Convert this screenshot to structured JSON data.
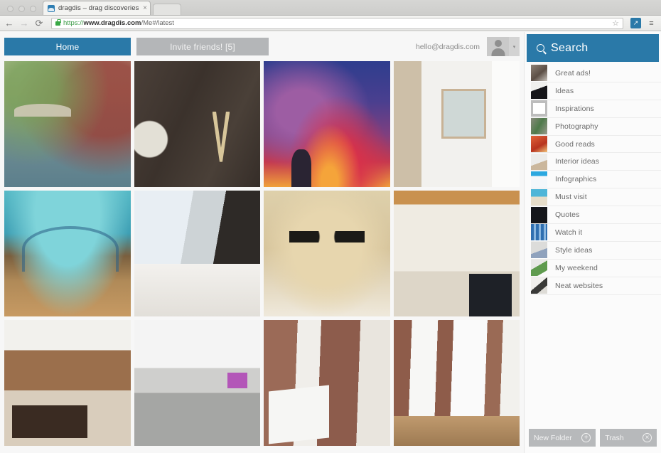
{
  "browser": {
    "tab": {
      "title": "dragdis – drag discoveries",
      "close_label": "×",
      "favicon": "dragdis-favicon"
    },
    "toolbar": {
      "back_label": "←",
      "forward_label": "→",
      "reload_label": "⟳",
      "url_scheme": "https",
      "url_separator": "://",
      "url_host": "www.dragdis.com",
      "url_path": "/Me#/latest",
      "bookmark_label": "☆",
      "extension_label": "↗",
      "menu_label": "≡"
    }
  },
  "appnav": {
    "home_label": "Home",
    "invite_label": "Invite friends! [5]",
    "user_email": "hello@dragdis.com",
    "caret_label": "▾"
  },
  "grid": {
    "tiles": [
      {
        "name": "venice-canal-bridge-boat",
        "art": "img-canal"
      },
      {
        "name": "live-food-lettering-wood",
        "art": "img-live"
      },
      {
        "name": "buddha-statue-sunset-sky",
        "art": "img-sunset"
      },
      {
        "name": "white-wood-wall-interior",
        "art": "img-whiteroom"
      },
      {
        "name": "underwater-aquarium-bedroom",
        "art": "img-underwater"
      },
      {
        "name": "attic-loft-bedroom-chandelier",
        "art": "img-attic"
      },
      {
        "name": "leopard-face-closeup",
        "art": "img-leopard"
      },
      {
        "name": "open-plan-loft-staircase",
        "art": "img-loft"
      },
      {
        "name": "classic-living-room-shelves",
        "art": "img-living"
      },
      {
        "name": "modern-open-office-imacs",
        "art": "img-office"
      },
      {
        "name": "brick-wall-kitchen-island",
        "art": "img-kitchen"
      },
      {
        "name": "brick-wall-white-doors",
        "art": "img-doors"
      }
    ]
  },
  "sidebar": {
    "search_label": "Search",
    "folders": [
      {
        "label": "Great ads!",
        "thumb": "t-greatads"
      },
      {
        "label": "Ideas",
        "thumb": "t-ideas"
      },
      {
        "label": "Inspirations",
        "thumb": "t-inspirations"
      },
      {
        "label": "Photography",
        "thumb": "t-photography"
      },
      {
        "label": "Good reads",
        "thumb": "t-goodreads"
      },
      {
        "label": "Interior ideas",
        "thumb": "t-interior"
      },
      {
        "label": "Infographics",
        "thumb": "t-infographics"
      },
      {
        "label": "Must visit",
        "thumb": "t-mustvisit"
      },
      {
        "label": "Quotes",
        "thumb": "t-quotes"
      },
      {
        "label": "Watch it",
        "thumb": "t-watchit"
      },
      {
        "label": "Style ideas",
        "thumb": "t-styleideas"
      },
      {
        "label": "My weekend",
        "thumb": "t-myweekend"
      },
      {
        "label": "Neat websites",
        "thumb": "t-neatwebsites"
      }
    ],
    "new_folder_label": "New Folder",
    "new_folder_icon": "+",
    "trash_label": "Trash",
    "trash_icon": "×"
  },
  "colors": {
    "accent_blue": "#2a79a8",
    "muted_gray": "#b7b9bb",
    "page_bg": "#f7f7f7"
  }
}
